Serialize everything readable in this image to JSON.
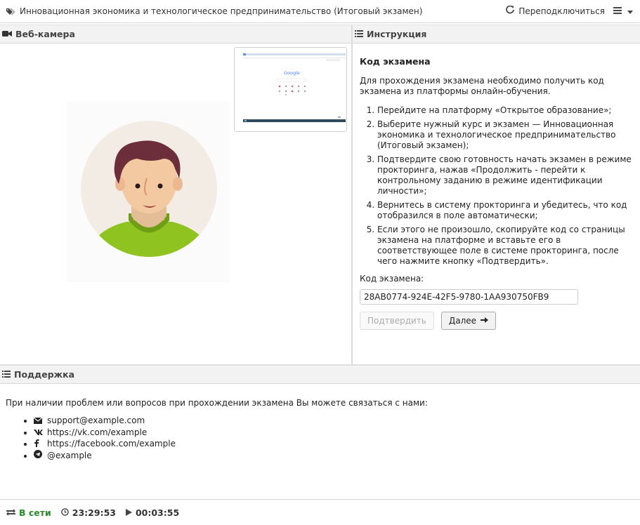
{
  "header": {
    "title": "Инновационная экономика и технологическое предпринимательство (Итоговый экзамен)",
    "reconnect_label": "Переподключиться",
    "tag_icon": "tag-icon",
    "reconnect_icon": "refresh-icon",
    "menu_icon": "hamburger-icon"
  },
  "webcam": {
    "heading": "Веб-камера",
    "icon": "video-camera-icon",
    "screen_preview_text": "Google"
  },
  "instructions": {
    "heading": "Инструкция",
    "icon": "list-icon",
    "title": "Код экзамена",
    "intro": "Для прохождения экзамена необходимо получить код экзамена из платформы онлайн-обучения.",
    "steps": [
      "Перейдите на платформу «Открытое образование»;",
      "Выберите нужный курс и экзамен — Инновационная экономика и технологическое предпринимательство (Итоговый экзамен);",
      "Подтвердите свою готовность начать экзамен в режиме прокторинга, нажав «Продолжить - перейти к контрольному заданию в режиме идентификации личности»;",
      "Вернитесь в систему прокторинга и убедитесь, что код отобразился в поле автоматически;",
      "Если этого не произошло, скопируйте код со страницы экзамена на платформе и вставьте его в соответствующее поле в системе прокторинга, после чего нажмите кнопку «Подтвердить»."
    ],
    "code_label": "Код экзамена:",
    "code_value": "28AB0774-924E-42F5-9780-1AA930750FB9",
    "confirm_label": "Подтвердить",
    "next_label": "Далее"
  },
  "support": {
    "heading": "Поддержка",
    "intro": "При наличии проблем или вопросов при прохождении экзамена Вы можете связаться с нами:",
    "contacts": [
      {
        "icon": "envelope-icon",
        "text": "support@example.com"
      },
      {
        "icon": "vk-icon",
        "text": "https://vk.com/example"
      },
      {
        "icon": "facebook-icon",
        "text": "https://facebook.com/example"
      },
      {
        "icon": "telegram-icon",
        "text": "@example"
      }
    ]
  },
  "status": {
    "connection": "В сети",
    "clock": "23:29:53",
    "elapsed": "00:03:55"
  },
  "colors": {
    "online": "#2a8a2a",
    "avatar_bg": "#f3ece4",
    "shirt": "#8fc31f",
    "hair": "#6b2e3a",
    "skin": "#f2c9a0"
  }
}
